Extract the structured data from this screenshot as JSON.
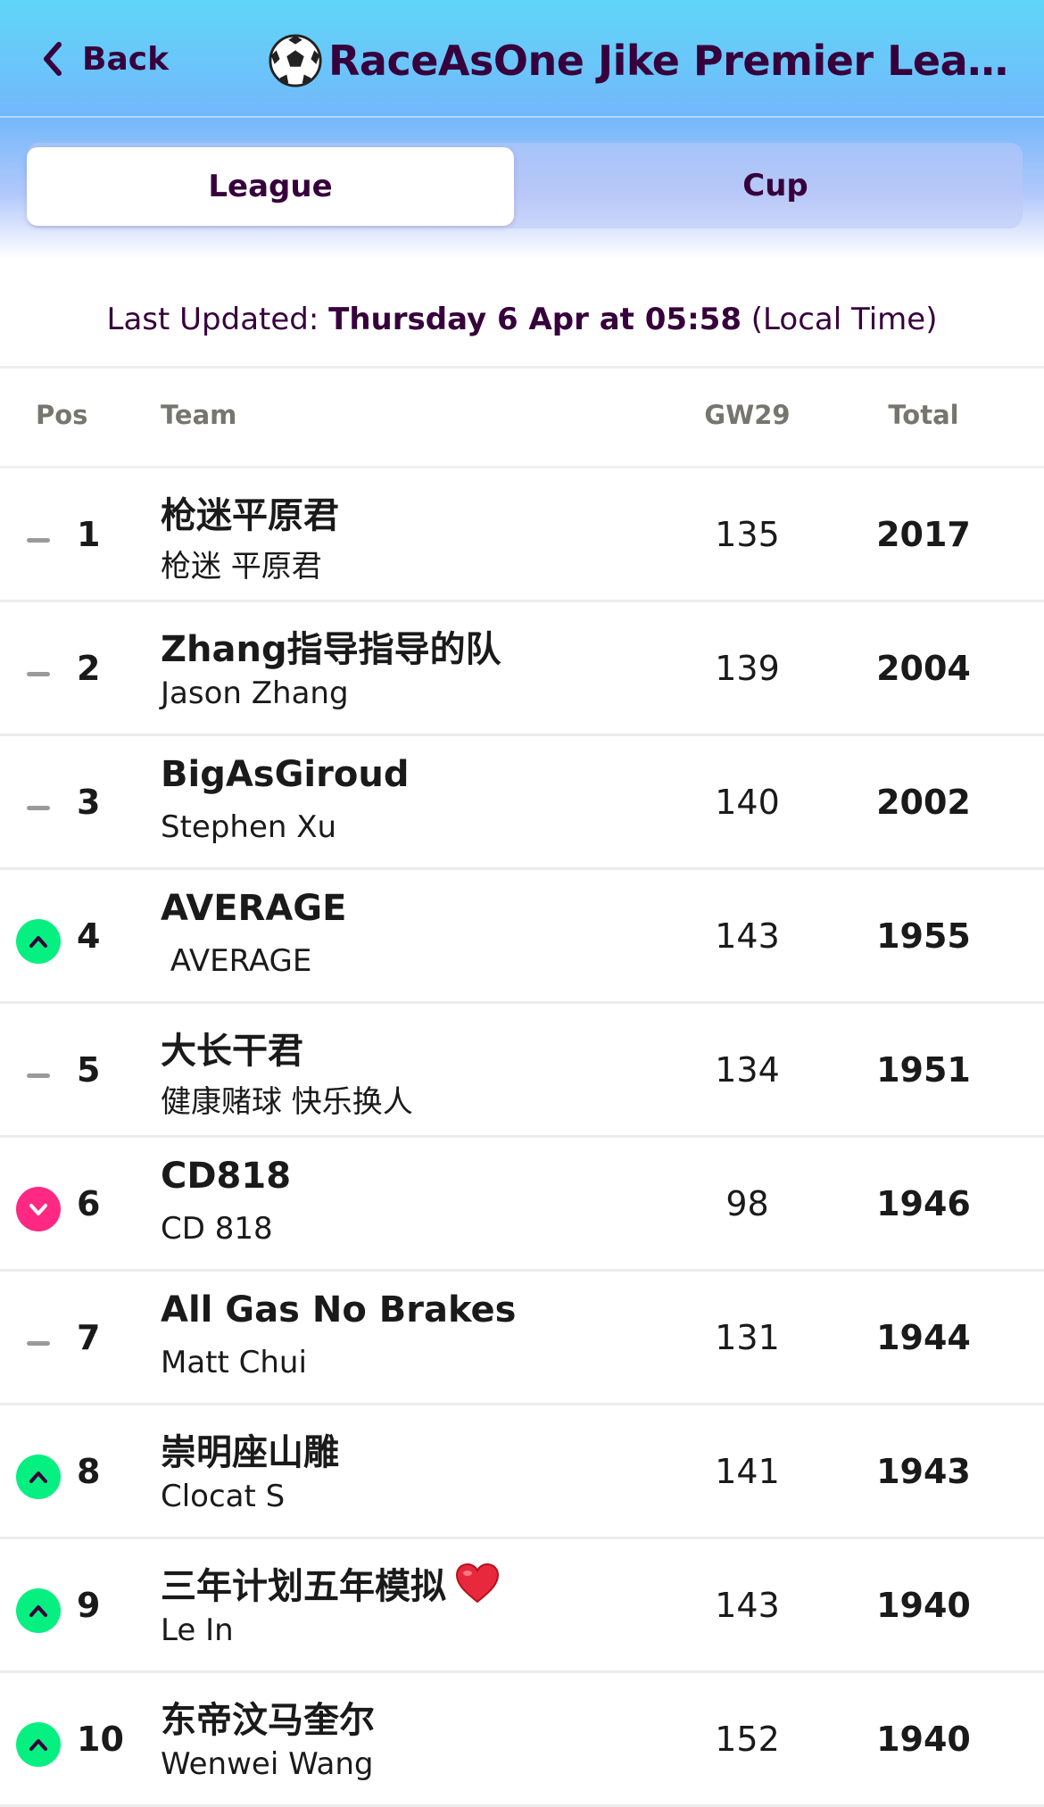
{
  "header": {
    "back_label": "Back",
    "title": "RaceAsOne Jike Premier Leag..."
  },
  "tabs": [
    {
      "label": "League",
      "active": true
    },
    {
      "label": "Cup",
      "active": false
    }
  ],
  "last_updated": {
    "prefix": "Last Updated: ",
    "value": "Thursday 6 Apr at 05:58",
    "suffix": " (Local Time)"
  },
  "columns": {
    "pos": "Pos",
    "team": "Team",
    "gw": "GW29",
    "total": "Total"
  },
  "colors": {
    "up": "#05f080",
    "down": "#ff2882",
    "same": "#9a9a9a",
    "primary": "#37003c"
  },
  "rows": [
    {
      "pos": "1",
      "movement": "same",
      "team": "枪迷平原君",
      "manager": "枪迷 平原君",
      "gw": "135",
      "total": "2017"
    },
    {
      "pos": "2",
      "movement": "same",
      "team": "Zhang指导指导的队",
      "manager": "Jason Zhang",
      "gw": "139",
      "total": "2004"
    },
    {
      "pos": "3",
      "movement": "same",
      "team": "BigAsGiroud",
      "manager": "Stephen Xu",
      "gw": "140",
      "total": "2002"
    },
    {
      "pos": "4",
      "movement": "up",
      "team": "AVERAGE",
      "manager": " AVERAGE",
      "gw": "143",
      "total": "1955"
    },
    {
      "pos": "5",
      "movement": "same",
      "team": "大长干君",
      "manager": "健康赌球 快乐换人",
      "gw": "134",
      "total": "1951"
    },
    {
      "pos": "6",
      "movement": "down",
      "team": "CD818",
      "manager": "CD 818",
      "gw": "98",
      "total": "1946"
    },
    {
      "pos": "7",
      "movement": "same",
      "team": "All Gas No Brakes",
      "manager": "Matt Chui",
      "gw": "131",
      "total": "1944"
    },
    {
      "pos": "8",
      "movement": "up",
      "team": "崇明座山雕",
      "manager": "Clocat S",
      "gw": "141",
      "total": "1943"
    },
    {
      "pos": "9",
      "movement": "up",
      "team": "三年计划五年模拟",
      "team_icon": "red-heart-icon",
      "manager": "Le In",
      "gw": "143",
      "total": "1940"
    },
    {
      "pos": "10",
      "movement": "up",
      "team": "东帝汶马奎尔",
      "manager": "Wenwei Wang",
      "gw": "152",
      "total": "1940"
    }
  ]
}
